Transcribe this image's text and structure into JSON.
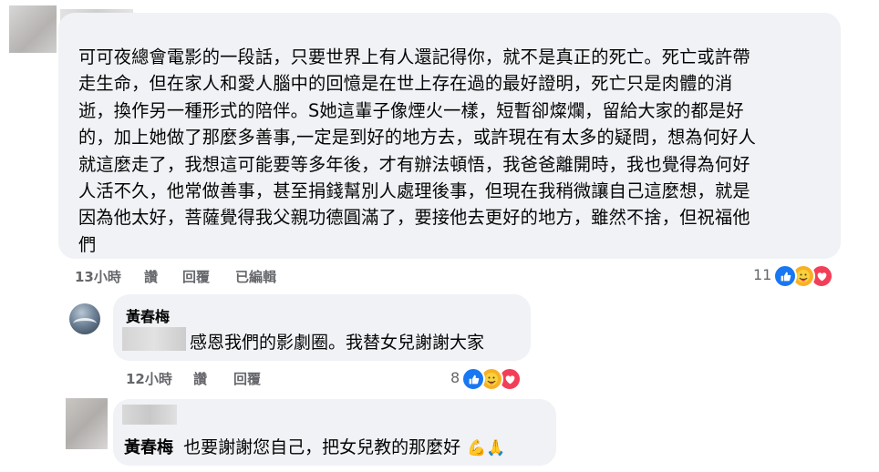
{
  "main_comment": {
    "body": "可可夜總會電影的一段話，只要世界上有人還記得你，就不是真正的死亡。死亡或許帶\n走生命，但在家人和愛人腦中的回憶是在世上存在過的最好證明，死亡只是肉體的消\n逝，換作另一種形式的陪伴。S她這輩子像煙火一樣，短暫卻燦爛，留給大家的都是好\n的，加上她做了那麼多善事,一定是到好的地方去，或許現在有太多的疑問，想為何好人\n就這麼走了，我想這可能要等多年後，才有辦法頓悟，我爸爸離開時，我也覺得為何好\n人活不久，他常做善事，甚至捐錢幫別人處理後事，但現在我稍微讓自己這麼想，就是\n因為他太好，菩薩覺得我父親功德圓滿了，要接他去更好的地方，雖然不捨，但祝福他\n們",
    "time": "13小時",
    "like_label": "讚",
    "reply_label": "回覆",
    "edited_label": "已編輯",
    "reaction_count": "11"
  },
  "reply_1": {
    "author": "黃春梅",
    "text": "感恩我們的影劇圈。我替女兒謝謝大家",
    "time": "12小時",
    "like_label": "讚",
    "reply_label": "回覆",
    "reaction_count": "8"
  },
  "reply_2": {
    "tagged_name": "黃春梅",
    "text": "也要謝謝您自己，把女兒教的那麼好",
    "emojis": "💪🙏"
  },
  "colors": {
    "bubble": "#f0f2f5",
    "meta": "#65676b",
    "like": "#1877f2",
    "care": "#f7b125",
    "love": "#f33e58"
  },
  "icons": [
    "like-reaction-icon",
    "care-reaction-icon",
    "love-reaction-icon"
  ]
}
